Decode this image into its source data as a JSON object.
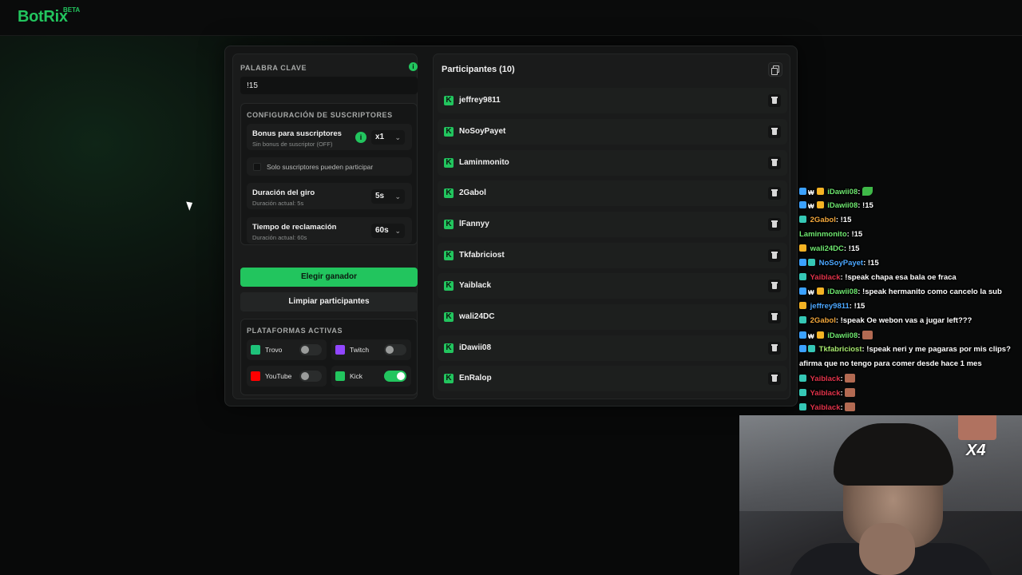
{
  "header": {
    "logo": "BotRix",
    "beta": "BETA"
  },
  "keyword": {
    "title": "PALABRA CLAVE",
    "value": "!15",
    "info_icon": "i"
  },
  "subscribers": {
    "title": "CONFIGURACIÓN DE SUSCRIPTORES",
    "bonus_label": "Bonus para suscriptores",
    "bonus_sub": "Sin bonus de suscriptor (OFF)",
    "bonus_info_icon": "i",
    "bonus_value": "x1",
    "only_subs_label": "Solo suscriptores pueden participar"
  },
  "spin": {
    "label": "Duración del giro",
    "sub": "Duración actual: 5s",
    "value": "5s"
  },
  "claim": {
    "label": "Tiempo de reclamación",
    "sub": "Duración actual: 60s",
    "value": "60s"
  },
  "actions": {
    "pick_winner": "Elegir ganador",
    "clear": "Limpiar participantes"
  },
  "platforms": {
    "title": "PLATAFORMAS ACTIVAS",
    "items": [
      {
        "name": "Trovo",
        "enabled": false,
        "color": "#1ec27a",
        "icon": "trovo-icon"
      },
      {
        "name": "Twitch",
        "enabled": false,
        "color": "#9146ff",
        "icon": "twitch-icon"
      },
      {
        "name": "YouTube",
        "enabled": false,
        "color": "#ff0000",
        "icon": "youtube-icon"
      },
      {
        "name": "Kick",
        "enabled": true,
        "color": "#22c55e",
        "icon": "kick-icon"
      }
    ]
  },
  "participants": {
    "title": "Participantes (10)",
    "list": [
      "jeffrey9811",
      "NoSoyPayet",
      "Laminmonito",
      "2Gabol",
      "lFannyy",
      "Tkfabriciost",
      "Yaiblack",
      "wali24DC",
      "iDawii08",
      "EnRalop"
    ]
  },
  "chat": {
    "messages": [
      {
        "user": "iDawii08",
        "color": "#6ee76f",
        "text": ": ",
        "emote": "green"
      },
      {
        "user": "iDawii08",
        "color": "#6ee76f",
        "text": ": !15"
      },
      {
        "user": "2Gabol",
        "color": "#f2a73b",
        "text": ": !15"
      },
      {
        "user": "Laminmonito",
        "color": "#6ee76f",
        "text": ": !15"
      },
      {
        "user": "wali24DC",
        "color": "#6ee76f",
        "text": ": !15"
      },
      {
        "user": "NoSoyPayet",
        "color": "#4ba7ff",
        "text": ": !15"
      },
      {
        "user": "Yaiblack",
        "color": "#e0334a",
        "text": ": !speak chapa esa bala oe fraca"
      },
      {
        "user": "iDawii08",
        "color": "#6ee76f",
        "text": ": !speak hermanito como cancelo la sub"
      },
      {
        "user": "jeffrey9811",
        "color": "#4ba7ff",
        "text": ": !15"
      },
      {
        "user": "2Gabol",
        "color": "#f2a73b",
        "text": ": !speak Oe webon vas a jugar left???"
      },
      {
        "user": "iDawii08",
        "color": "#6ee76f",
        "text": ": ",
        "emote": "face"
      },
      {
        "user": "Tkfabriciost",
        "color": "#a6e86e",
        "text": ": !speak neri y me pagaras por mis clips?"
      },
      {
        "user": "",
        "color": "#ffffff",
        "text": "afirma que no tengo para comer desde hace 1 mes"
      },
      {
        "user": "Yaiblack",
        "color": "#e0334a",
        "text": ": ",
        "emote": "face"
      },
      {
        "user": "Yaiblack",
        "color": "#e0334a",
        "text": ": ",
        "emote": "face"
      },
      {
        "user": "Yaiblack",
        "color": "#e0334a",
        "text": ": ",
        "emote": "face"
      }
    ]
  },
  "webcam": {
    "overlay": "X4"
  }
}
